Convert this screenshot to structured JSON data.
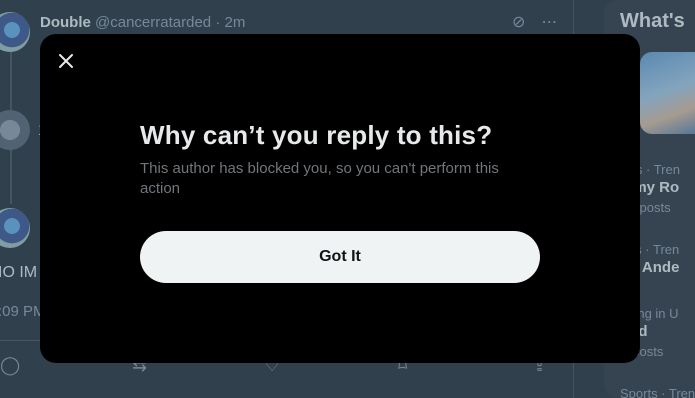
{
  "background": {
    "tweet": {
      "author_name": "Double",
      "author_handle": "@cancerratarded",
      "separator": "·",
      "time": "2m",
      "body_fragment": "IO IM",
      "timestamp_fragment": ":09 PM",
      "mid_fragment": "1"
    },
    "sidebar": {
      "title": "What's",
      "trends": [
        {
          "meta": "itics · Tren",
          "name": "mmy Ro",
          "count": "2K posts"
        },
        {
          "meta": "orts · Tren",
          "name": "iot Ande",
          "count": ""
        },
        {
          "meta": "nding in U",
          "name": "ood",
          "count": "K posts"
        },
        {
          "meta": "Sports · Tren",
          "name": "",
          "count": ""
        }
      ]
    }
  },
  "modal": {
    "title": "Why can’t you reply to this?",
    "body": "This author has blocked you, so you can't perform this action",
    "button_label": "Got It",
    "close_icon": "close-icon"
  },
  "colors": {
    "modal_bg": "#000000",
    "button_bg": "#eff3f4",
    "button_text": "#0f1419",
    "muted_text": "#71767b"
  }
}
